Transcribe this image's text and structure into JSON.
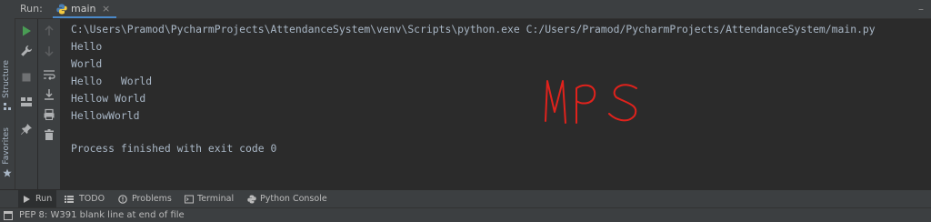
{
  "left_strip": {
    "structure_label": "Structure",
    "favorites_label": "Favorites"
  },
  "header": {
    "run_label": "Run:",
    "tab_label": "main",
    "close_glyph": "×",
    "right_glyph": "–"
  },
  "console": {
    "command": "C:\\Users\\Pramod\\PycharmProjects\\AttendanceSystem\\venv\\Scripts\\python.exe C:/Users/Pramod/PycharmProjects/AttendanceSystem/main.py",
    "lines": [
      "Hello",
      "World",
      "Hello   World",
      "Hellow World",
      "HellowWorld"
    ],
    "exit_message": "Process finished with exit code 0",
    "watermark_text": "MPS"
  },
  "bottom_tabs": [
    {
      "label": "Run",
      "icon": "play-icon"
    },
    {
      "label": "TODO",
      "icon": "list-icon"
    },
    {
      "label": "Problems",
      "icon": "problems-icon"
    },
    {
      "label": "Terminal",
      "icon": "terminal-icon"
    },
    {
      "label": "Python Console",
      "icon": "python-console-icon"
    }
  ],
  "status_bar": {
    "message": "PEP 8: W391 blank line at end of file"
  },
  "colors": {
    "background": "#2b2b2b",
    "panel": "#3c3f41",
    "text": "#a9b7c6",
    "run_green": "#499c54",
    "scribble_red": "#e0221c",
    "tab_underline": "#4a88c7"
  }
}
